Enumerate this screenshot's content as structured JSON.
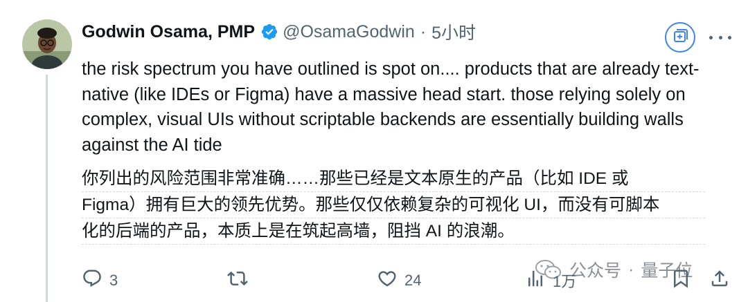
{
  "tweet": {
    "author_name": "Godwin Osama, PMP",
    "author_handle": "@OsamaGodwin",
    "separator": "·",
    "time": "5小时",
    "text": "the risk spectrum you have outlined is spot on.... products that are already text-native (like IDEs or Figma) have a massive head start. those relying solely on complex, visual UIs without scriptable backends are essentially building walls against the AI tide",
    "translation_lines": [
      "你列出的风险范围非常准确……那些已经是文本原生的产品（比如 IDE 或",
      "Figma）拥有巨大的领先优势。那些仅仅依赖复杂的可视化 UI，而没有可脚本",
      "化的后端的产品，本质上是在筑起高墙，阻挡 AI 的浪潮。"
    ]
  },
  "actions": {
    "reply_count": "3",
    "retweet_count": "",
    "like_count": "24",
    "views_count": "1万"
  },
  "watermark": {
    "source": "公众号",
    "separator": "·",
    "name": "量子位"
  },
  "icons": {
    "verified": "verified-badge-icon",
    "grok": "grok-icon",
    "more": "more-icon",
    "reply": "reply-icon",
    "retweet": "retweet-icon",
    "like": "like-icon",
    "views": "views-icon",
    "bookmark": "bookmark-icon",
    "share": "share-icon"
  },
  "colors": {
    "accent": "#1d9bf0",
    "text_primary": "#0f1419",
    "text_secondary": "#536471",
    "grok_border": "#3b82f6"
  }
}
